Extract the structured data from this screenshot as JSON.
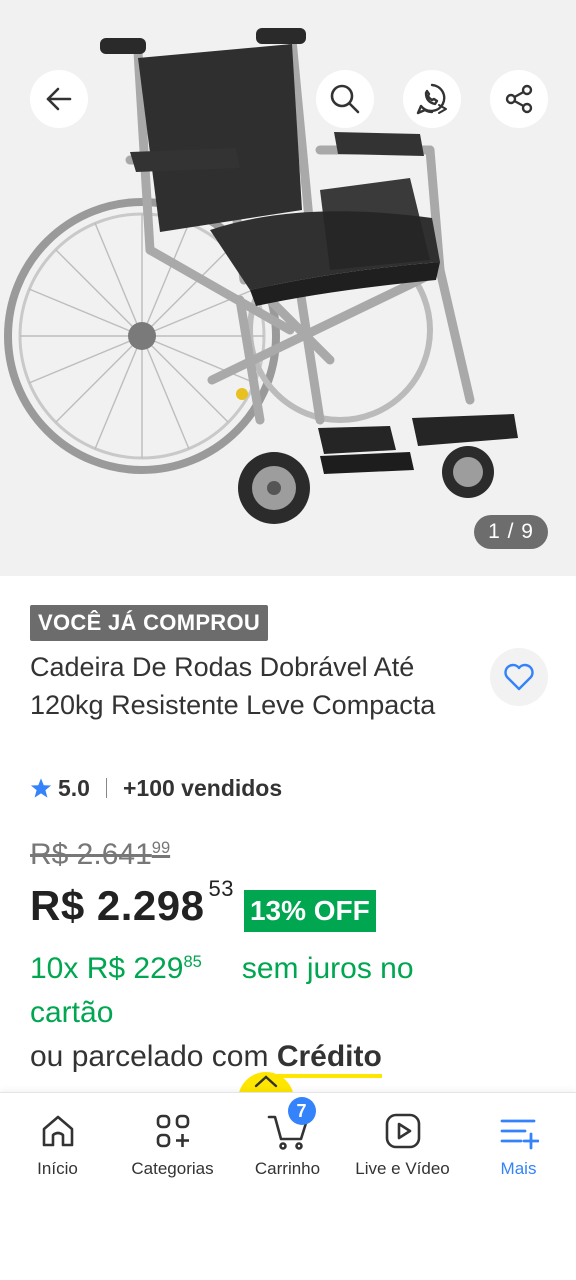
{
  "gallery": {
    "image_alt": "cadeira-de-rodas",
    "counter": "1 / 9",
    "buttons": [
      "back-icon",
      "search-icon",
      "whatsapp-icon",
      "share-icon"
    ]
  },
  "product": {
    "purchased_badge": "VOCÊ JÁ COMPROU",
    "title": "Cadeira De Rodas Dobrável Até 120kg Resistente Leve Compacta",
    "rating": "5.0",
    "sold": "+100 vendidos",
    "favorite_icon": "heart-icon"
  },
  "pricing": {
    "old_price_main": "R$ 2.641",
    "old_price_cents": "99",
    "price_main": "R$ 2.298",
    "price_cents": "53",
    "discount": "13% OFF",
    "installment_main": "10x R$ 229",
    "installment_cents": "85",
    "installment_note": "sem juros no cartão",
    "credit_prefix": "ou parcelado com ",
    "credit_link": "Crédito"
  },
  "bottom_nav": {
    "items": [
      {
        "label": "Início",
        "icon": "home-icon"
      },
      {
        "label": "Categorias",
        "icon": "categories-icon"
      },
      {
        "label": "Carrinho",
        "icon": "cart-icon",
        "badge": "7"
      },
      {
        "label": "Live e Vídeo",
        "icon": "play-icon"
      },
      {
        "label": "Mais",
        "icon": "menu-plus-icon",
        "active": true
      }
    ]
  },
  "colors": {
    "accent": "#3483fa",
    "green": "#00a650",
    "yellow": "#ffe600",
    "badge_gray": "#6c6c6c"
  }
}
